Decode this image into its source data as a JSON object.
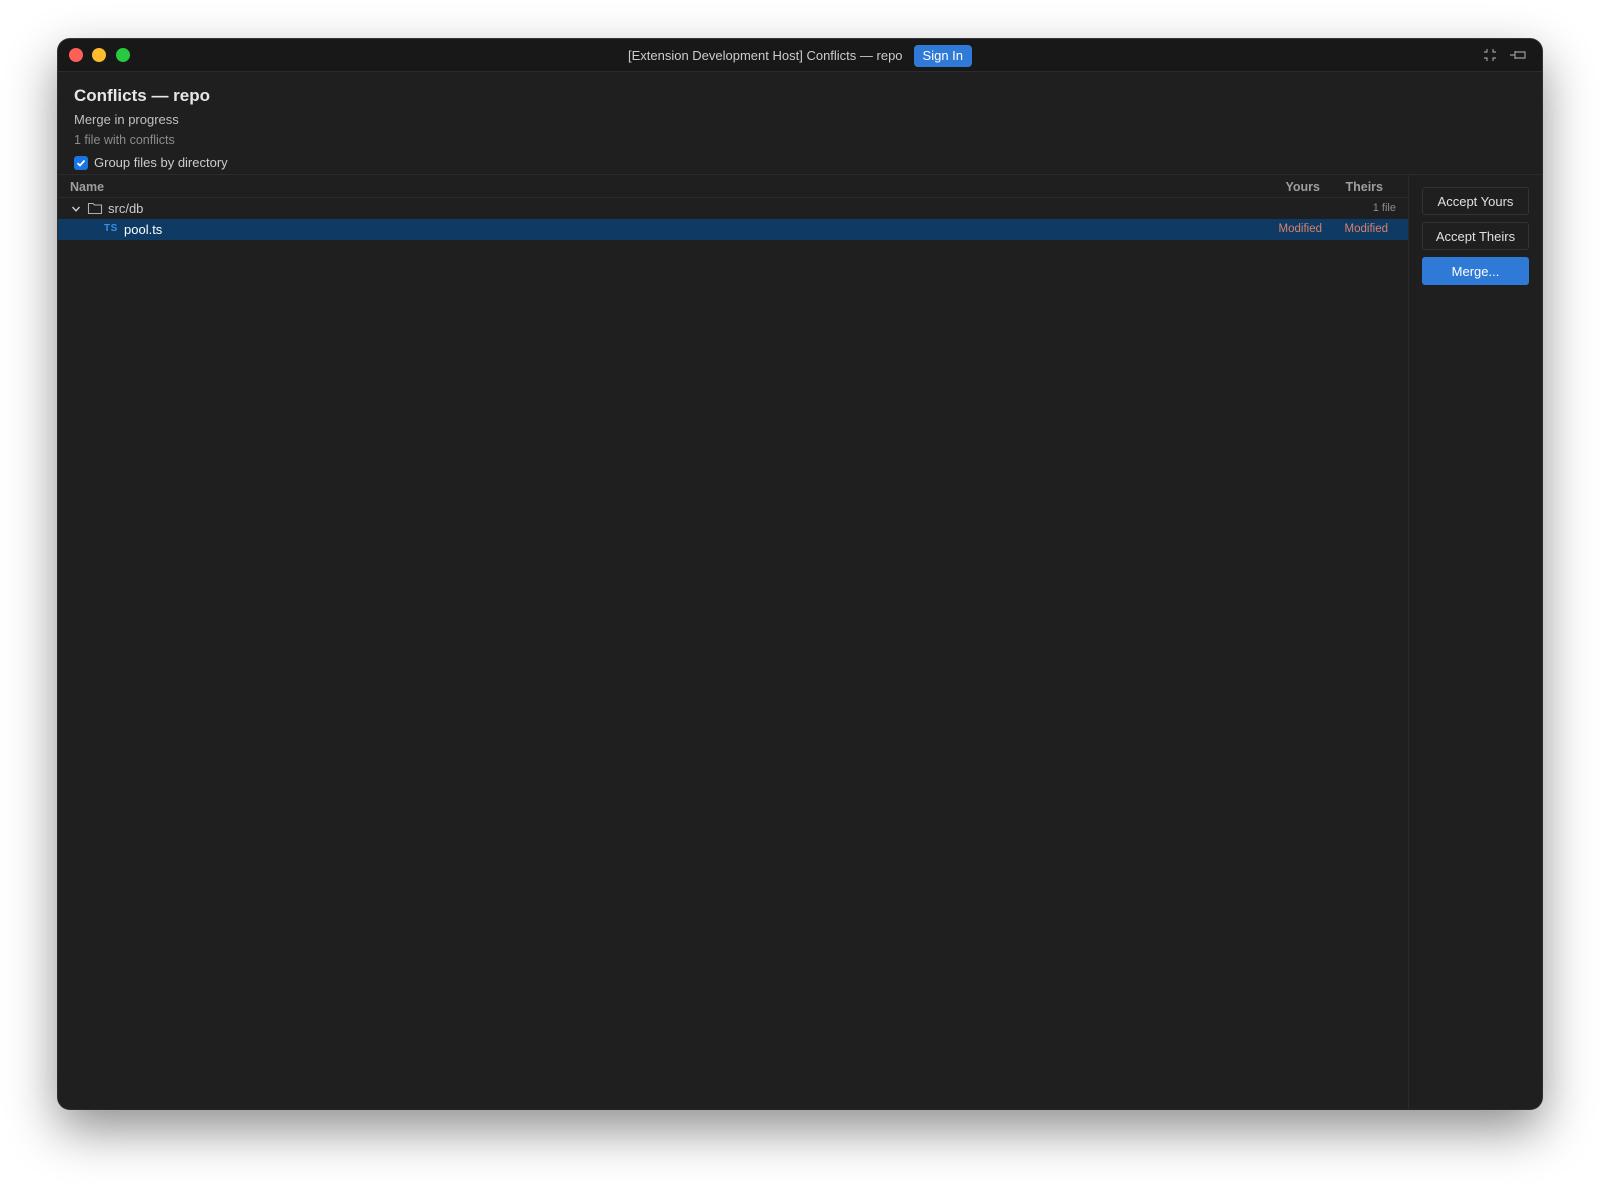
{
  "window": {
    "title": "[Extension Development Host] Conflicts — repo",
    "signin_label": "Sign In"
  },
  "header": {
    "title": "Conflicts — repo",
    "subtitle": "Merge in progress",
    "count": "1 file with conflicts",
    "group_label": "Group files by directory",
    "group_checked": true
  },
  "columns": {
    "name": "Name",
    "yours": "Yours",
    "theirs": "Theirs"
  },
  "tree": {
    "directory": {
      "label": "src/db",
      "count": "1 file",
      "icon": "folder-icon"
    },
    "file": {
      "type_badge": "TS",
      "label": "pool.ts",
      "yours": "Modified",
      "theirs": "Modified"
    }
  },
  "actions": {
    "accept_yours": "Accept Yours",
    "accept_theirs": "Accept Theirs",
    "merge": "Merge..."
  },
  "colors": {
    "accent": "#2f7ad6",
    "selection": "#0e3a63",
    "status_modified": "#d9826b"
  }
}
